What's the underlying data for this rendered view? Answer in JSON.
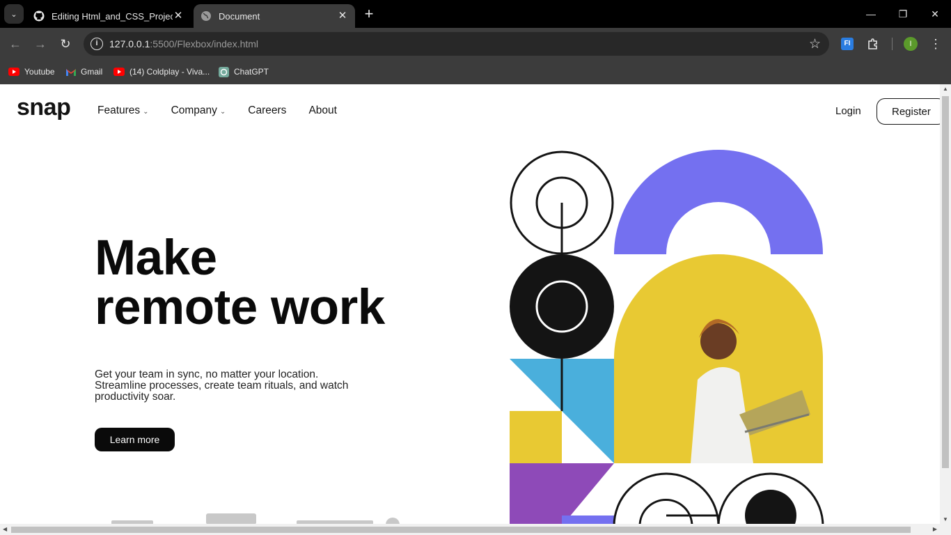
{
  "browser": {
    "tabs": [
      {
        "title": "Editing Html_and_CSS_Project_l",
        "favicon": "github-icon",
        "active": false
      },
      {
        "title": "Document",
        "favicon": "globe-icon",
        "active": true
      }
    ],
    "url_host": "127.0.0.1",
    "url_rest": ":5500/Flexbox/index.html",
    "profile_initial": "I",
    "extension_label": "FI",
    "bookmarks": [
      {
        "label": "Youtube",
        "icon": "youtube-icon"
      },
      {
        "label": "Gmail",
        "icon": "gmail-icon"
      },
      {
        "label": "(14) Coldplay - Viva...",
        "icon": "youtube-icon"
      },
      {
        "label": "ChatGPT",
        "icon": "chatgpt-icon"
      }
    ],
    "colors": {
      "chrome_bg": "#3c3c3c",
      "tabstrip_bg": "#000000",
      "omnibox_bg": "#282828"
    }
  },
  "site": {
    "logo": "snap",
    "nav": {
      "features": "Features",
      "company": "Company",
      "careers": "Careers",
      "about": "About"
    },
    "login": "Login",
    "register": "Register",
    "hero": {
      "title_line1": "Make",
      "title_line2": "remote work",
      "subtitle": "Get your team in sync, no matter your location. Streamline processes, create team rituals, and watch productivity soar.",
      "cta": "Learn more"
    },
    "colors": {
      "text": "#141414",
      "purple_arch": "#7470f0",
      "yellow": "#e8c933",
      "cyan": "#4aafdc",
      "violet": "#8e4ab8"
    }
  }
}
